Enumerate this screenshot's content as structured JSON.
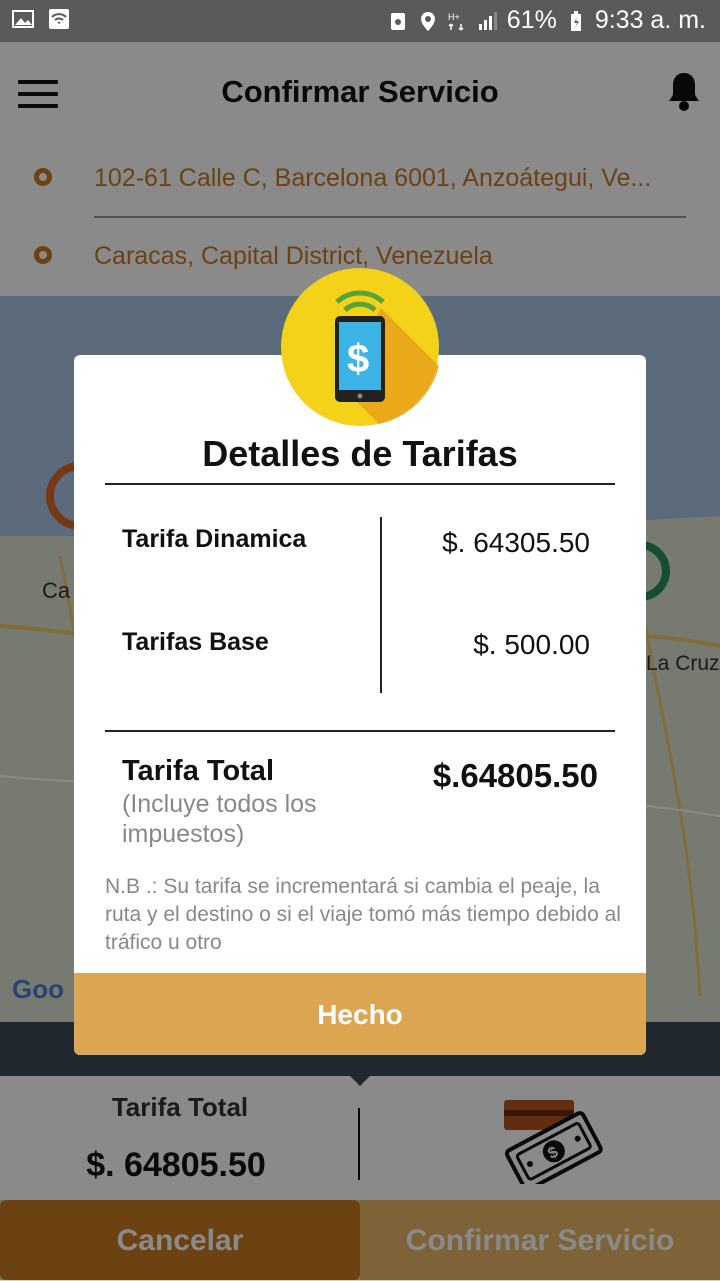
{
  "status_bar": {
    "battery": "61%",
    "time": "9:33 a. m.",
    "icons": [
      "image-icon",
      "wifi-icon",
      "battery-saver-icon",
      "location-icon",
      "hplus-icon",
      "signal-icon",
      "battery-icon"
    ]
  },
  "header": {
    "title": "Confirmar Servicio",
    "menu_icon": "menu-icon",
    "bell_icon": "bell-icon"
  },
  "addresses": {
    "origin": "102-61 Calle C, Barcelona 6001, Anzoátegui, Ve...",
    "destination": "Caracas, Capital District, Venezuela"
  },
  "map": {
    "labels": [
      "Ca",
      "La Cruz",
      "Goo"
    ]
  },
  "modal": {
    "icon": "payment-phone-icon",
    "title": "Detalles de Tarifas",
    "rows": [
      {
        "label": "Tarifa Dinamica",
        "value": "$. 64305.50"
      },
      {
        "label": "Tarifas Base",
        "value": "$. 500.00"
      }
    ],
    "total_label": "Tarifa Total",
    "total_note": "(Incluye todos los impuestos)",
    "total_value": "$.64805.50",
    "nb": "N.B .: Su tarifa se incrementará si cambia el peaje, la ruta y el destino o si el viaje tomó más tiempo debido al tráfico u otro",
    "done_button": "Hecho"
  },
  "summary": {
    "label": "Tarifa Total",
    "value": "$. 64805.50",
    "icon": "cash-icon"
  },
  "buttons": {
    "cancel": "Cancelar",
    "confirm": "Confirmar Servicio"
  },
  "colors": {
    "accent": "#c77a22",
    "done_button": "#dca552",
    "badge": "#f4d21a"
  }
}
